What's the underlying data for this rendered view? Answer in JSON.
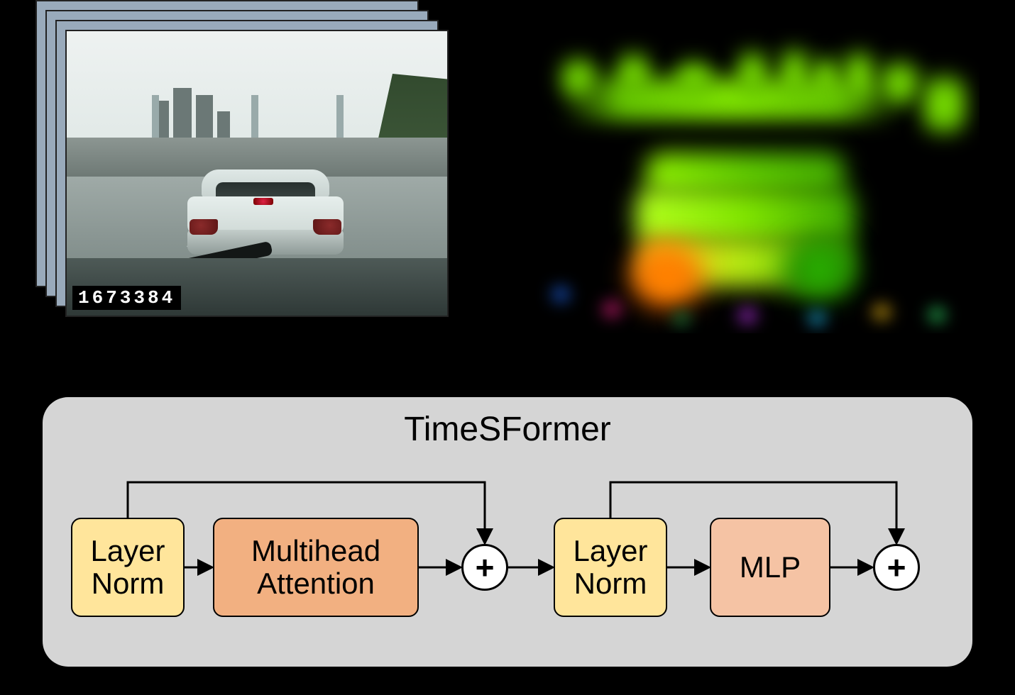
{
  "diagram": {
    "title": "TimeSFormer",
    "blocks": {
      "ln1": "Layer\nNorm",
      "attention": "Multihead\nAttention",
      "add1": "+",
      "ln2": "Layer\nNorm",
      "mlp": "MLP",
      "add2": "+"
    },
    "flow": [
      "ln1",
      "attention",
      "add1",
      "ln2",
      "mlp",
      "add2"
    ],
    "residuals": [
      [
        "ln1",
        "add1"
      ],
      [
        "ln2",
        "add2"
      ]
    ]
  },
  "inputs": {
    "left": {
      "type": "video_frames",
      "description": "Stacked dashcam frames (vehicle following a white sedan on highway, city skyline and overpass)",
      "timestamp": "1673384"
    },
    "right": {
      "type": "activation_map",
      "description": "Color activation / attention map highlighting skyline edge and rear of lead vehicle (green/yellow high activation, orange on tail-lights)"
    }
  }
}
